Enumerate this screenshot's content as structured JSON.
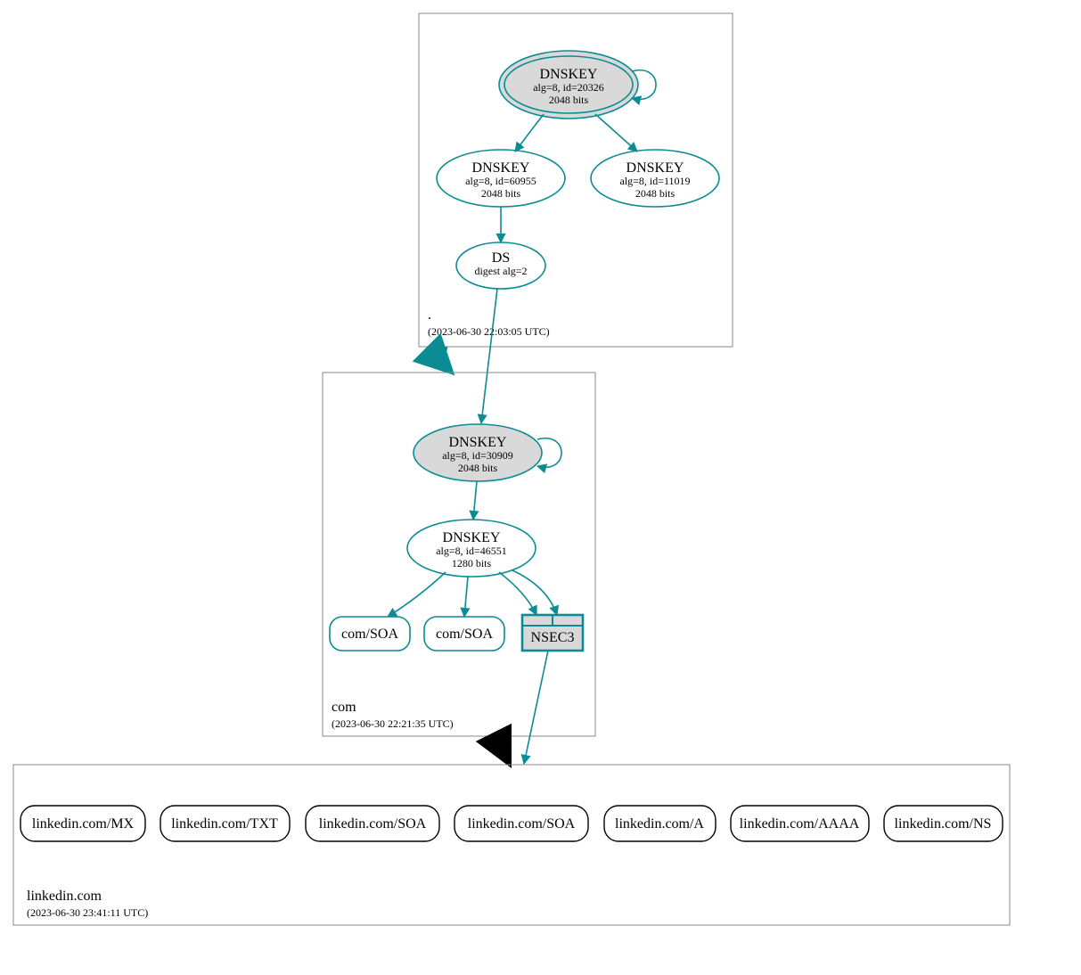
{
  "colors": {
    "teal": "#0b8b93",
    "black": "#000000",
    "gray_fill": "#d9d9d9",
    "nsec3_fill": "#d9d9d9",
    "box_stroke": "#888888"
  },
  "zones": {
    "root": {
      "label": ".",
      "timestamp": "(2023-06-30 22:03:05 UTC)",
      "nodes": {
        "ksk": {
          "title": "DNSKEY",
          "line2": "alg=8, id=20326",
          "line3": "2048 bits"
        },
        "zsk1": {
          "title": "DNSKEY",
          "line2": "alg=8, id=60955",
          "line3": "2048 bits"
        },
        "zsk2": {
          "title": "DNSKEY",
          "line2": "alg=8, id=11019",
          "line3": "2048 bits"
        },
        "ds": {
          "title": "DS",
          "line2": "digest alg=2"
        }
      }
    },
    "com": {
      "label": "com",
      "timestamp": "(2023-06-30 22:21:35 UTC)",
      "nodes": {
        "ksk": {
          "title": "DNSKEY",
          "line2": "alg=8, id=30909",
          "line3": "2048 bits"
        },
        "zsk": {
          "title": "DNSKEY",
          "line2": "alg=8, id=46551",
          "line3": "1280 bits"
        },
        "soa1": {
          "title": "com/SOA"
        },
        "soa2": {
          "title": "com/SOA"
        },
        "nsec3": {
          "title": "NSEC3"
        }
      }
    },
    "linkedin": {
      "label": "linkedin.com",
      "timestamp": "(2023-06-30 23:41:11 UTC)",
      "nodes": {
        "mx": {
          "title": "linkedin.com/MX"
        },
        "txt": {
          "title": "linkedin.com/TXT"
        },
        "soa1": {
          "title": "linkedin.com/SOA"
        },
        "soa2": {
          "title": "linkedin.com/SOA"
        },
        "a": {
          "title": "linkedin.com/A"
        },
        "aaaa": {
          "title": "linkedin.com/AAAA"
        },
        "ns": {
          "title": "linkedin.com/NS"
        }
      }
    }
  }
}
